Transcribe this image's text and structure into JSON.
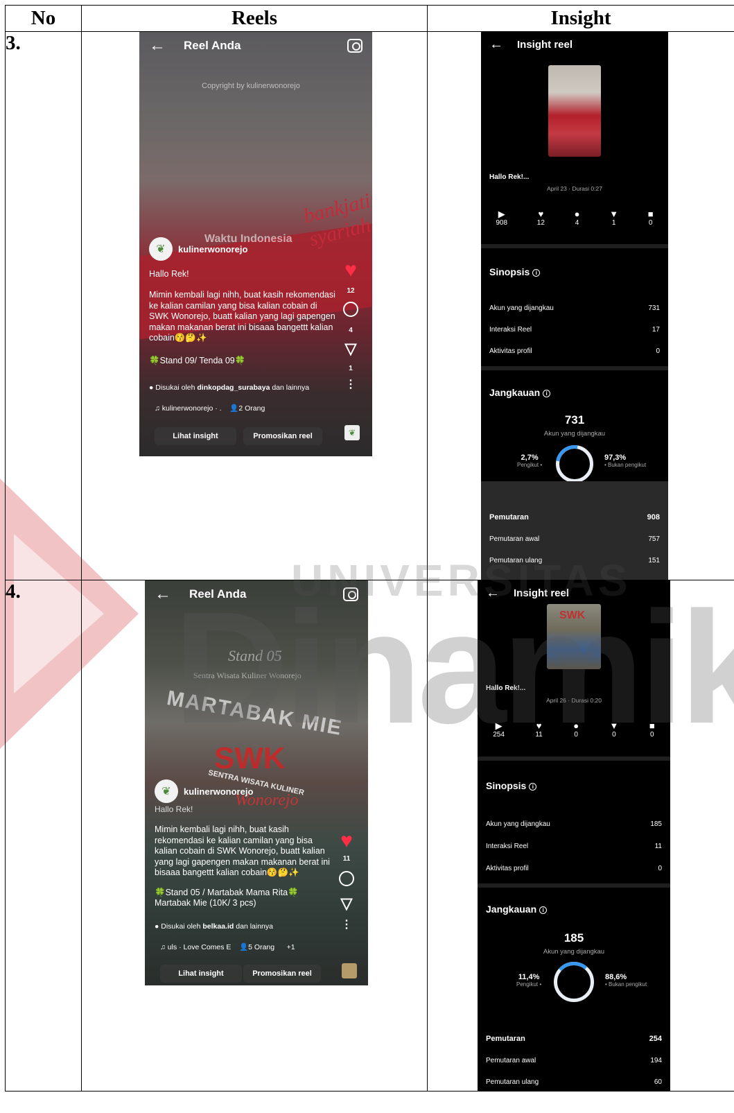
{
  "table": {
    "headers": {
      "no": "No",
      "reels": "Reels",
      "insight": "Insight"
    },
    "rows": [
      {
        "number": "3.",
        "reel": {
          "title": "Reel Anda",
          "copyright": "Copyright by kulinerwonorejo",
          "overlay_time": "Waktu Indonesia",
          "bank_logo": "bankjatim syariah",
          "username": "kulinerwonorejo",
          "caption_heading": "Hallo Rek!",
          "caption_body": "Mimin kembali lagi nihh, buat kasih rekomendasi ke kalian camilan yang bisa kalian cobain di SWK Wonorejo, buatt kalian yang lagi gapengen makan makanan berat ini bisaaa bangettt kalian cobain😚🤔✨",
          "stand": "🍀Stand 09/ Tenda 09🍀",
          "liked_by_prefix": "Disukai oleh ",
          "liked_by_user": "dinkopdag_surabaya",
          "liked_by_suffix": " dan lainnya",
          "audio": "kulinerwonorejo · .",
          "people": "2 Orang",
          "like_count": "12",
          "comment_count": "4",
          "share_count": "1",
          "btn_insight": "Lihat insight",
          "btn_promote": "Promosikan reel"
        },
        "insight": {
          "title": "Insight reel",
          "hallo": "Hallo Rek!...",
          "date": "April 23 · Durasi 0:27",
          "stats": [
            "908",
            "12",
            "4",
            "1",
            "0"
          ],
          "sinopsis_title": "Sinopsis",
          "sinopsis": [
            {
              "label": "Akun yang dijangkau",
              "value": "731"
            },
            {
              "label": "Interaksi Reel",
              "value": "17"
            },
            {
              "label": "Aktivitas profil",
              "value": "0"
            }
          ],
          "jangkauan_title": "Jangkauan",
          "reach": "731",
          "reach_label": "Akun yang dijangkau",
          "follower_pct": "2,7%",
          "follower_label": "Pengikut •",
          "follower_fraction": 0.027,
          "nonfollower_pct": "97,3%",
          "nonfollower_label": "• Bukan pengikut",
          "plays_title": "Pemutaran",
          "plays": "908",
          "plays_initial_label": "Pemutaran awal",
          "plays_initial": "757",
          "plays_replay_label": "Pemutaran ulang",
          "plays_replay": "151"
        }
      },
      {
        "number": "4.",
        "reel": {
          "title": "Reel Anda",
          "overlay_stand": "Stand 05",
          "overlay_place": "Sentra Wisata Kuliner Wonorejo",
          "overlay_menu": "MARTABAK MIE",
          "sign": "SWK",
          "sign_sub": "SENTRA WISATA KULINER",
          "sign_place": "Wonorejo",
          "username": "kulinerwonorejo",
          "caption_heading": "Hallo Rek!",
          "caption_body": "Mimin kembali lagi nihh, buat kasih rekomendasi ke kalian camilan yang bisa kalian cobain di SWK Wonorejo, buatt kalian yang lagi gapengen makan makanan berat ini bisaaa bangettt kalian cobain😚🤔✨",
          "stand": "🍀Stand 05 / Martabak Mama Rita🍀",
          "stand_menu": "Martabak Mie (10K/ 3 pcs)",
          "liked_by_prefix": "Disukai oleh ",
          "liked_by_user": "belkaa.id",
          "liked_by_suffix": " dan lainnya",
          "audio": "uls · Love Comes E",
          "people": "5 Orang",
          "people_extra": "+1",
          "like_count": "11",
          "btn_insight": "Lihat insight",
          "btn_promote": "Promosikan reel"
        },
        "insight": {
          "title": "Insight reel",
          "thumb_sign": "SWK",
          "hallo": "Hallo Rek!...",
          "date": "April 26 · Durasi 0:20",
          "stats": [
            "254",
            "11",
            "0",
            "0",
            "0"
          ],
          "sinopsis_title": "Sinopsis",
          "sinopsis": [
            {
              "label": "Akun yang dijangkau",
              "value": "185"
            },
            {
              "label": "Interaksi Reel",
              "value": "11"
            },
            {
              "label": "Aktivitas profil",
              "value": "0"
            }
          ],
          "jangkauan_title": "Jangkauan",
          "reach": "185",
          "reach_label": "Akun yang dijangkau",
          "follower_pct": "11,4%",
          "follower_label": "Pengikut •",
          "follower_fraction": 0.114,
          "nonfollower_pct": "88,6%",
          "nonfollower_label": "• Bukan pengikut",
          "plays_title": "Pemutaran",
          "plays": "254",
          "plays_initial_label": "Pemutaran awal",
          "plays_initial": "194",
          "plays_replay_label": "Pemutaran ulang",
          "plays_replay": "60"
        }
      }
    ]
  },
  "watermark": {
    "top": "UNIVERSITAS",
    "main": "Dinamika"
  },
  "colors": {
    "accent_blue": "#3897f0",
    "like_red": "#ff2d46",
    "watermark_red": "#d22630"
  }
}
